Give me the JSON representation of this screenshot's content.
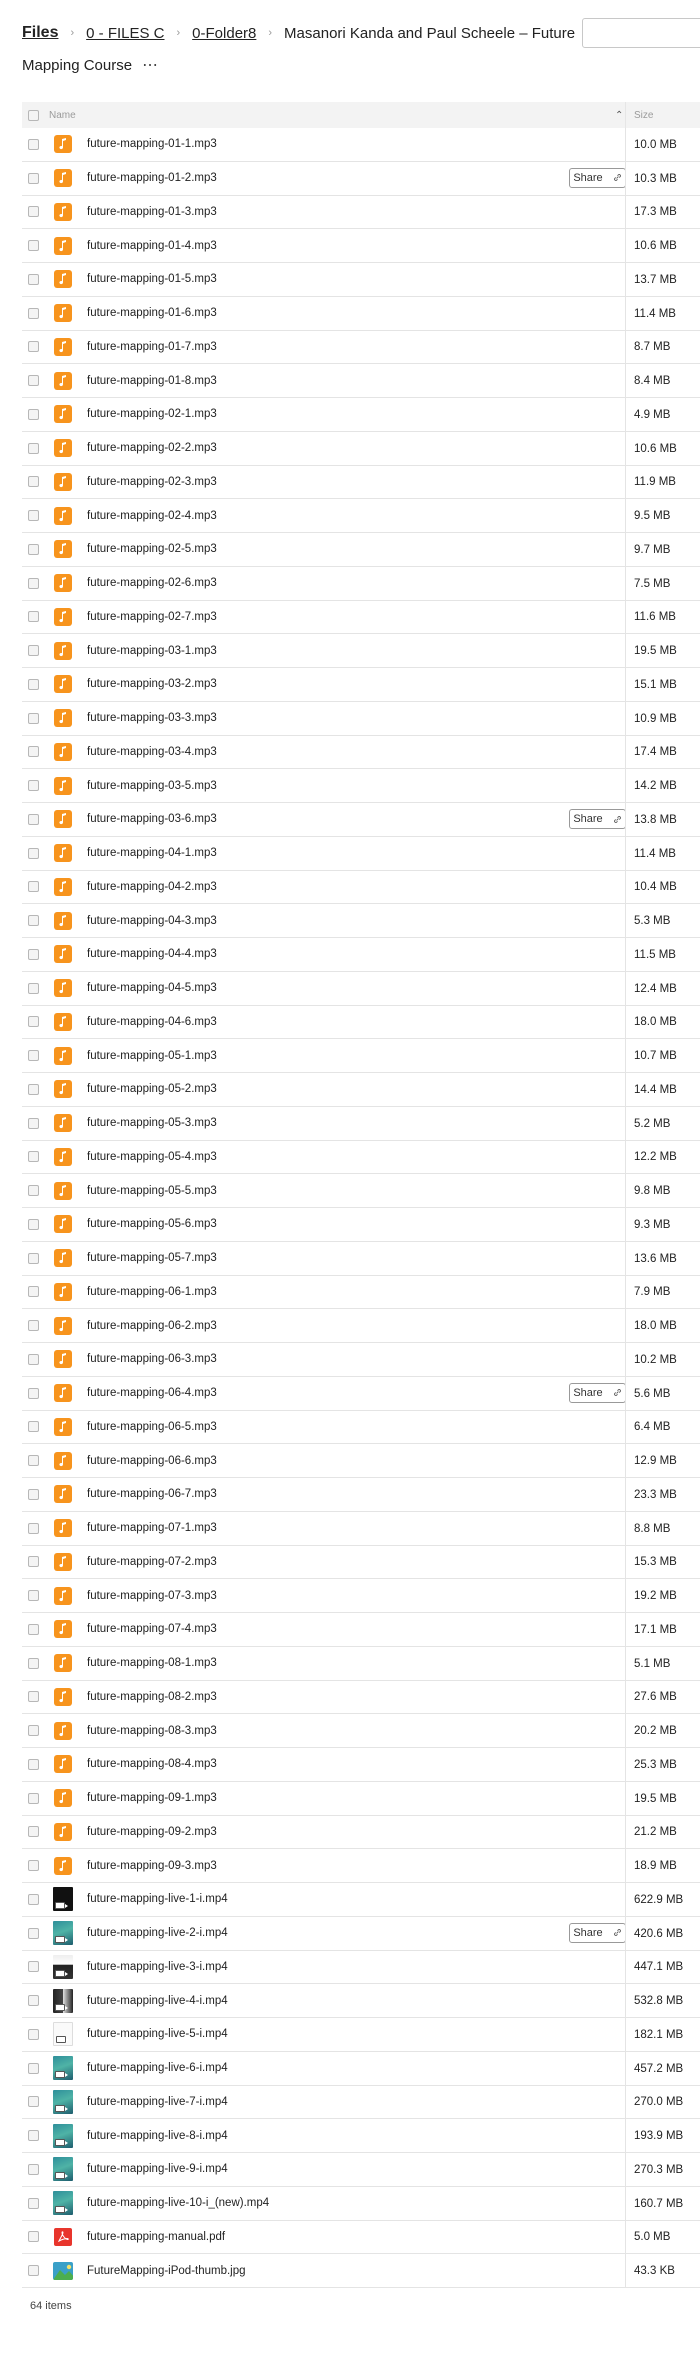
{
  "breadcrumb": {
    "root": "Files",
    "items": [
      "0 - FILES C",
      "0-Folder8"
    ],
    "current_line1": "Masanori Kanda and Paul Scheele – Future",
    "current_line2": "Mapping Course",
    "more": "⋯"
  },
  "search": {
    "placeholder": ""
  },
  "table": {
    "header_name": "Name",
    "header_size": "Size",
    "share_label": "Share"
  },
  "files": [
    {
      "name": "future-mapping-01-1.mp3",
      "size": "10.0 MB",
      "type": "audio"
    },
    {
      "name": "future-mapping-01-2.mp3",
      "size": "10.3 MB",
      "type": "audio",
      "share": true
    },
    {
      "name": "future-mapping-01-3.mp3",
      "size": "17.3 MB",
      "type": "audio"
    },
    {
      "name": "future-mapping-01-4.mp3",
      "size": "10.6 MB",
      "type": "audio"
    },
    {
      "name": "future-mapping-01-5.mp3",
      "size": "13.7 MB",
      "type": "audio"
    },
    {
      "name": "future-mapping-01-6.mp3",
      "size": "11.4 MB",
      "type": "audio"
    },
    {
      "name": "future-mapping-01-7.mp3",
      "size": "8.7 MB",
      "type": "audio"
    },
    {
      "name": "future-mapping-01-8.mp3",
      "size": "8.4 MB",
      "type": "audio"
    },
    {
      "name": "future-mapping-02-1.mp3",
      "size": "4.9 MB",
      "type": "audio"
    },
    {
      "name": "future-mapping-02-2.mp3",
      "size": "10.6 MB",
      "type": "audio"
    },
    {
      "name": "future-mapping-02-3.mp3",
      "size": "11.9 MB",
      "type": "audio"
    },
    {
      "name": "future-mapping-02-4.mp3",
      "size": "9.5 MB",
      "type": "audio"
    },
    {
      "name": "future-mapping-02-5.mp3",
      "size": "9.7 MB",
      "type": "audio"
    },
    {
      "name": "future-mapping-02-6.mp3",
      "size": "7.5 MB",
      "type": "audio"
    },
    {
      "name": "future-mapping-02-7.mp3",
      "size": "11.6 MB",
      "type": "audio"
    },
    {
      "name": "future-mapping-03-1.mp3",
      "size": "19.5 MB",
      "type": "audio"
    },
    {
      "name": "future-mapping-03-2.mp3",
      "size": "15.1 MB",
      "type": "audio"
    },
    {
      "name": "future-mapping-03-3.mp3",
      "size": "10.9 MB",
      "type": "audio"
    },
    {
      "name": "future-mapping-03-4.mp3",
      "size": "17.4 MB",
      "type": "audio"
    },
    {
      "name": "future-mapping-03-5.mp3",
      "size": "14.2 MB",
      "type": "audio"
    },
    {
      "name": "future-mapping-03-6.mp3",
      "size": "13.8 MB",
      "type": "audio",
      "share": true
    },
    {
      "name": "future-mapping-04-1.mp3",
      "size": "11.4 MB",
      "type": "audio"
    },
    {
      "name": "future-mapping-04-2.mp3",
      "size": "10.4 MB",
      "type": "audio"
    },
    {
      "name": "future-mapping-04-3.mp3",
      "size": "5.3 MB",
      "type": "audio"
    },
    {
      "name": "future-mapping-04-4.mp3",
      "size": "11.5 MB",
      "type": "audio"
    },
    {
      "name": "future-mapping-04-5.mp3",
      "size": "12.4 MB",
      "type": "audio"
    },
    {
      "name": "future-mapping-04-6.mp3",
      "size": "18.0 MB",
      "type": "audio"
    },
    {
      "name": "future-mapping-05-1.mp3",
      "size": "10.7 MB",
      "type": "audio"
    },
    {
      "name": "future-mapping-05-2.mp3",
      "size": "14.4 MB",
      "type": "audio"
    },
    {
      "name": "future-mapping-05-3.mp3",
      "size": "5.2 MB",
      "type": "audio"
    },
    {
      "name": "future-mapping-05-4.mp3",
      "size": "12.2 MB",
      "type": "audio"
    },
    {
      "name": "future-mapping-05-5.mp3",
      "size": "9.8 MB",
      "type": "audio"
    },
    {
      "name": "future-mapping-05-6.mp3",
      "size": "9.3 MB",
      "type": "audio"
    },
    {
      "name": "future-mapping-05-7.mp3",
      "size": "13.6 MB",
      "type": "audio"
    },
    {
      "name": "future-mapping-06-1.mp3",
      "size": "7.9 MB",
      "type": "audio"
    },
    {
      "name": "future-mapping-06-2.mp3",
      "size": "18.0 MB",
      "type": "audio"
    },
    {
      "name": "future-mapping-06-3.mp3",
      "size": "10.2 MB",
      "type": "audio"
    },
    {
      "name": "future-mapping-06-4.mp3",
      "size": "5.6 MB",
      "type": "audio",
      "share": true
    },
    {
      "name": "future-mapping-06-5.mp3",
      "size": "6.4 MB",
      "type": "audio"
    },
    {
      "name": "future-mapping-06-6.mp3",
      "size": "12.9 MB",
      "type": "audio"
    },
    {
      "name": "future-mapping-06-7.mp3",
      "size": "23.3 MB",
      "type": "audio"
    },
    {
      "name": "future-mapping-07-1.mp3",
      "size": "8.8 MB",
      "type": "audio"
    },
    {
      "name": "future-mapping-07-2.mp3",
      "size": "15.3 MB",
      "type": "audio"
    },
    {
      "name": "future-mapping-07-3.mp3",
      "size": "19.2 MB",
      "type": "audio"
    },
    {
      "name": "future-mapping-07-4.mp3",
      "size": "17.1 MB",
      "type": "audio"
    },
    {
      "name": "future-mapping-08-1.mp3",
      "size": "5.1 MB",
      "type": "audio"
    },
    {
      "name": "future-mapping-08-2.mp3",
      "size": "27.6 MB",
      "type": "audio"
    },
    {
      "name": "future-mapping-08-3.mp3",
      "size": "20.2 MB",
      "type": "audio"
    },
    {
      "name": "future-mapping-08-4.mp3",
      "size": "25.3 MB",
      "type": "audio"
    },
    {
      "name": "future-mapping-09-1.mp3",
      "size": "19.5 MB",
      "type": "audio"
    },
    {
      "name": "future-mapping-09-2.mp3",
      "size": "21.2 MB",
      "type": "audio"
    },
    {
      "name": "future-mapping-09-3.mp3",
      "size": "18.9 MB",
      "type": "audio"
    },
    {
      "name": "future-mapping-live-1-i.mp4",
      "size": "622.9 MB",
      "type": "video",
      "thumb": "dark"
    },
    {
      "name": "future-mapping-live-2-i.mp4",
      "size": "420.6 MB",
      "type": "video",
      "thumb": "teal",
      "share": true
    },
    {
      "name": "future-mapping-live-3-i.mp4",
      "size": "447.1 MB",
      "type": "video",
      "thumb": "slide"
    },
    {
      "name": "future-mapping-live-4-i.mp4",
      "size": "532.8 MB",
      "type": "video",
      "thumb": "stage"
    },
    {
      "name": "future-mapping-live-5-i.mp4",
      "size": "182.1 MB",
      "type": "video",
      "thumb": "white"
    },
    {
      "name": "future-mapping-live-6-i.mp4",
      "size": "457.2 MB",
      "type": "video",
      "thumb": "teal"
    },
    {
      "name": "future-mapping-live-7-i.mp4",
      "size": "270.0 MB",
      "type": "video",
      "thumb": "teal"
    },
    {
      "name": "future-mapping-live-8-i.mp4",
      "size": "193.9 MB",
      "type": "video",
      "thumb": "teal"
    },
    {
      "name": "future-mapping-live-9-i.mp4",
      "size": "270.3 MB",
      "type": "video",
      "thumb": "teal"
    },
    {
      "name": "future-mapping-live-10-i_(new).mp4",
      "size": "160.7 MB",
      "type": "video",
      "thumb": "teal"
    },
    {
      "name": "future-mapping-manual.pdf",
      "size": "5.0 MB",
      "type": "pdf"
    },
    {
      "name": "FutureMapping-iPod-thumb.jpg",
      "size": "43.3 KB",
      "type": "image"
    }
  ],
  "footer": {
    "count": "64 items"
  },
  "colors": {
    "audio": "#f7941d",
    "pdf": "#e8352c",
    "border": "#e4e4e4",
    "header_bg": "#f3f3f3"
  }
}
